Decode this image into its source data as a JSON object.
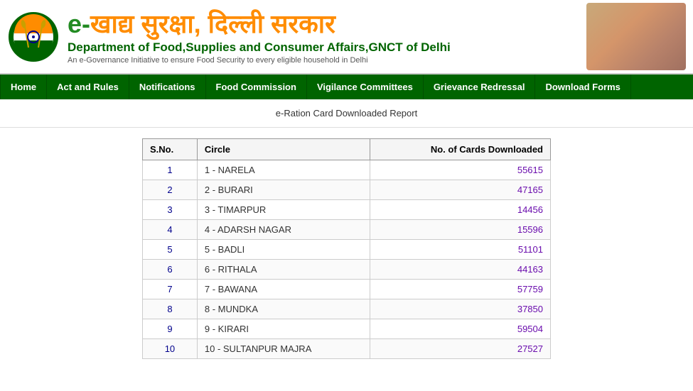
{
  "header": {
    "title_prefix": "e-",
    "title_hindi": "खाद्य सुरक्षा, दिल्ली सरकार",
    "subtitle": "Department of Food,Supplies and Consumer Affairs,GNCT of Delhi",
    "tagline": "An e-Governance Initiative to ensure Food Security to every eligible household in Delhi"
  },
  "nav": {
    "items": [
      {
        "label": "Home",
        "id": "home"
      },
      {
        "label": "Act and Rules",
        "id": "act-rules"
      },
      {
        "label": "Notifications",
        "id": "notifications"
      },
      {
        "label": "Food Commission",
        "id": "food-commission"
      },
      {
        "label": "Vigilance Committees",
        "id": "vigilance"
      },
      {
        "label": "Grievance Redressal",
        "id": "grievance"
      },
      {
        "label": "Download Forms",
        "id": "download-forms"
      }
    ]
  },
  "page_title": "e-Ration Card Downloaded Report",
  "table": {
    "headers": [
      "S.No.",
      "Circle",
      "No. of Cards Downloaded"
    ],
    "rows": [
      {
        "sno": "1",
        "circle": "1 - NARELA",
        "count": "55615"
      },
      {
        "sno": "2",
        "circle": "2 - BURARI",
        "count": "47165"
      },
      {
        "sno": "3",
        "circle": "3 - TIMARPUR",
        "count": "14456"
      },
      {
        "sno": "4",
        "circle": "4 - ADARSH NAGAR",
        "count": "15596"
      },
      {
        "sno": "5",
        "circle": "5 - BADLI",
        "count": "51101"
      },
      {
        "sno": "6",
        "circle": "6 - RITHALA",
        "count": "44163"
      },
      {
        "sno": "7",
        "circle": "7 - BAWANA",
        "count": "57759"
      },
      {
        "sno": "8",
        "circle": "8 - MUNDKA",
        "count": "37850"
      },
      {
        "sno": "9",
        "circle": "9 - KIRARI",
        "count": "59504"
      },
      {
        "sno": "10",
        "circle": "10 - SULTANPUR MAJRA",
        "count": "27527"
      }
    ]
  }
}
